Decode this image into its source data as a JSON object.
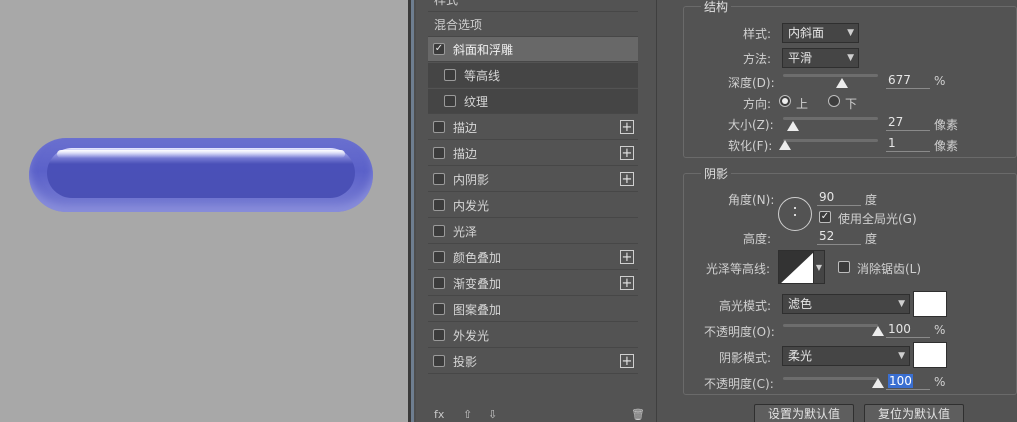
{
  "style_list": {
    "top_partial": "样式",
    "blend_options": "混合选项",
    "items": [
      {
        "label": "斜面和浮雕",
        "checked": true,
        "active": true,
        "sub": false,
        "plus": false
      },
      {
        "label": "等高线",
        "checked": false,
        "active": false,
        "sub": true,
        "plus": false
      },
      {
        "label": "纹理",
        "checked": false,
        "active": false,
        "sub": true,
        "plus": false
      },
      {
        "label": "描边",
        "checked": false,
        "active": false,
        "sub": false,
        "plus": true
      },
      {
        "label": "描边",
        "checked": false,
        "active": false,
        "sub": false,
        "plus": true
      },
      {
        "label": "内阴影",
        "checked": false,
        "active": false,
        "sub": false,
        "plus": true
      },
      {
        "label": "内发光",
        "checked": false,
        "active": false,
        "sub": false,
        "plus": false
      },
      {
        "label": "光泽",
        "checked": false,
        "active": false,
        "sub": false,
        "plus": false
      },
      {
        "label": "颜色叠加",
        "checked": false,
        "active": false,
        "sub": false,
        "plus": true
      },
      {
        "label": "渐变叠加",
        "checked": false,
        "active": false,
        "sub": false,
        "plus": true
      },
      {
        "label": "图案叠加",
        "checked": false,
        "active": false,
        "sub": false,
        "plus": false
      },
      {
        "label": "外发光",
        "checked": false,
        "active": false,
        "sub": false,
        "plus": false
      },
      {
        "label": "投影",
        "checked": false,
        "active": false,
        "sub": false,
        "plus": true
      }
    ],
    "bottom_fx": "fx",
    "bottom_up": "⇧",
    "bottom_down": "⇩",
    "bottom_trash": "🗑"
  },
  "structure": {
    "title": "结构",
    "style_label": "样式:",
    "style_value": "内斜面",
    "technique_label": "方法:",
    "technique_value": "平滑",
    "depth_label": "深度(D):",
    "depth_value": "677",
    "depth_unit": "%",
    "depth_level": 0.62,
    "direction_label": "方向:",
    "direction_up": "上",
    "direction_down": "下",
    "size_label": "大小(Z):",
    "size_value": "27",
    "size_unit": "像素",
    "size_level": 0.1,
    "soften_label": "软化(F):",
    "soften_value": "1",
    "soften_unit": "像素",
    "soften_level": 0.02
  },
  "shading": {
    "title": "阴影",
    "angle_label": "角度(N):",
    "angle_value": "90",
    "angle_unit": "度",
    "global_light_label": "使用全局光(G)",
    "altitude_label": "高度:",
    "altitude_value": "52",
    "altitude_unit": "度",
    "gloss_contour_label": "光泽等高线:",
    "anti_alias_label": "消除锯齿(L)",
    "highlight_mode_label": "高光模式:",
    "highlight_mode_value": "滤色",
    "highlight_color": "#ffffff",
    "highlight_opacity_label": "不透明度(O):",
    "highlight_opacity_value": "100",
    "highlight_opacity_unit": "%",
    "shadow_mode_label": "阴影模式:",
    "shadow_mode_value": "柔光",
    "shadow_color": "#ffffff",
    "shadow_opacity_label": "不透明度(C):",
    "shadow_opacity_value": "100",
    "shadow_opacity_unit": "%"
  },
  "buttons": {
    "make_default": "设置为默认值",
    "reset_default": "复位为默认值"
  }
}
